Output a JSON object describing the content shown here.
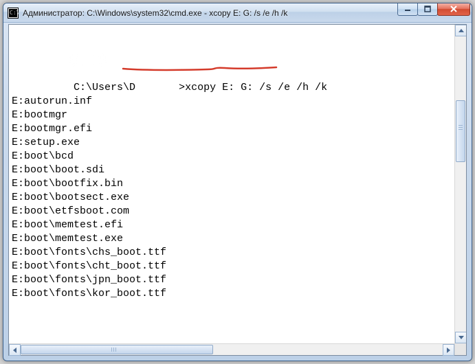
{
  "window": {
    "title": "Администратор: C:\\Windows\\system32\\cmd.exe - xcopy  E: G: /s /e /h /k"
  },
  "console": {
    "prompt_prefix": "C:\\Users\\D",
    "prompt_suffix": ">",
    "command": "xcopy E: G: /s /e /h /k",
    "output_lines": [
      "E:autorun.inf",
      "E:bootmgr",
      "E:bootmgr.efi",
      "E:setup.exe",
      "E:boot\\bcd",
      "E:boot\\boot.sdi",
      "E:boot\\bootfix.bin",
      "E:boot\\bootsect.exe",
      "E:boot\\etfsboot.com",
      "E:boot\\memtest.efi",
      "E:boot\\memtest.exe",
      "E:boot\\fonts\\chs_boot.ttf",
      "E:boot\\fonts\\cht_boot.ttf",
      "E:boot\\fonts\\jpn_boot.ttf",
      "E:boot\\fonts\\kor_boot.ttf"
    ]
  },
  "annotation": {
    "underline_color": "#d43a2a"
  }
}
